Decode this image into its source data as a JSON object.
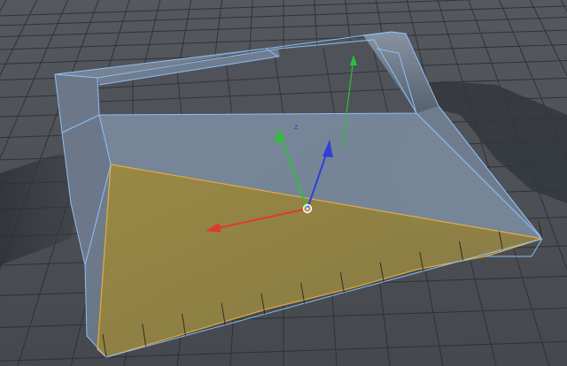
{
  "viewport": {
    "view": "perspective",
    "background_color": "#4b4e53",
    "grid_color": "#2a2c30",
    "model_color": "#6a7a8e",
    "wireframe_color": "#8fc4ff",
    "selection_color": "#c9a233",
    "selection_edge_color": "#f0b43c"
  },
  "gizmo": {
    "type": "move",
    "x_axis_color": "#e03a2e",
    "y_axis_color": "#2fbf3a",
    "z_axis_color": "#2f3fd8",
    "pivot_icon": "pivot-circle-icon"
  }
}
